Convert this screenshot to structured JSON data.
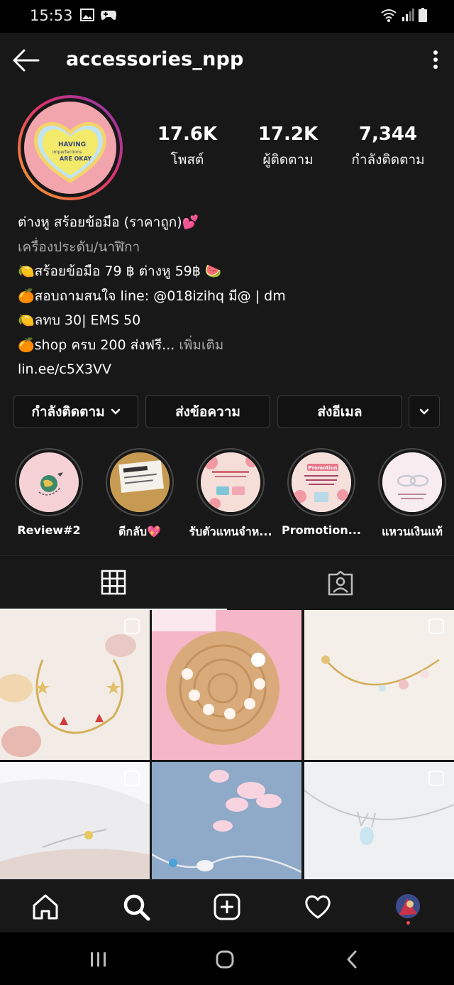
{
  "status": {
    "time": "15:53"
  },
  "profile": {
    "username": "accessories_npp",
    "avatar_text": [
      "HAVING",
      "imperfections",
      "ARE OKAY"
    ],
    "stats": [
      {
        "value": "17.6K",
        "label": "โพสต์"
      },
      {
        "value": "17.2K",
        "label": "ผู้ติดตาม"
      },
      {
        "value": "7,344",
        "label": "กำลังติดตาม"
      }
    ],
    "bio": {
      "name": "ต่างหู สร้อยข้อมือ (ราคาถูก)💕",
      "category": "เครื่องประดับ/นาฬิกา",
      "lines": [
        "🍋สร้อยข้อมือ 79 ฿ ต่างหู 59฿ 🍉",
        "🍊สอบถามสนใจ line:  @018izihq มี@ | dm",
        "🍋ลทบ 30| EMS 50",
        "🍊shop ครบ 200 ส่งฟรี..."
      ],
      "more": "เพิ่มเติม",
      "link": "lin.ee/c5X3VV"
    }
  },
  "buttons": {
    "following": "กำลังติดตาม",
    "message": "ส่งข้อความ",
    "email": "ส่งอีเมล"
  },
  "highlights": [
    {
      "label": "Review#2"
    },
    {
      "label": "ตีกลับ💖"
    },
    {
      "label": "รับตัวแทนจำห..."
    },
    {
      "label": "Promotion...",
      "badge": "Promotion"
    },
    {
      "label": "แหวนเงินแท้"
    }
  ],
  "colors": {
    "background": "#181818",
    "button_bg": "#121212",
    "button_border": "#3c3c3c",
    "secondary_text": "#a8a8a8"
  }
}
